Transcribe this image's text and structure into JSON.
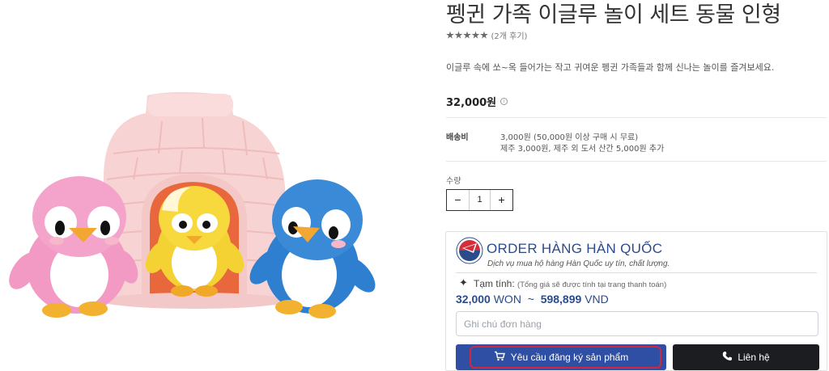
{
  "product": {
    "title": "펭귄 가족 이글루 놀이 세트 동물 인형",
    "rating_stars": 5,
    "review_count": "(2개 후기)",
    "description": "이글루 속에 쏘~옥 들어가는 작고 귀여운 펭귄 가족들과 함께 신나는 놀이를 즐겨보세요.",
    "price": "32,000원",
    "info_icon": "i",
    "shipping_label": "배송비",
    "shipping_line1": "3,000원 (50,000원 이상 구매 시 무료)",
    "shipping_line2": "제주 3,000원, 제주 외 도서 산간 5,000원 추가",
    "quantity_label": "수량",
    "quantity_minus": "−",
    "quantity_value": "1",
    "quantity_plus": "+"
  },
  "order_widget": {
    "brand_title": "ORDER HÀNG HÀN QUỐC",
    "brand_subtitle": "Dịch vụ mua hộ hàng Hàn Quốc uy tín, chất lượng.",
    "estimate_label": "Tạm tính:",
    "estimate_note": "(Tổng giá sẽ được tính tại trang thanh toán)",
    "estimate_won": "32,000",
    "estimate_won_unit": "WON",
    "estimate_sep": "~",
    "estimate_vnd": "598,899",
    "estimate_vnd_unit": "VND",
    "note_placeholder": "Ghi chú đơn hàng",
    "request_button": "Yêu cầu đăng ký sản phẩm",
    "contact_button": "Liên hệ"
  },
  "icons": {
    "sparkle": "sparkle-icon",
    "cart": "cart-icon",
    "phone": "phone-icon",
    "info": "info-icon",
    "logo": "korea-order-logo"
  },
  "colors": {
    "brand_blue": "#2e4fa3",
    "text_blue": "#2b4b8c",
    "contact_dark": "#1c1d20",
    "highlight_red": "#d0283a",
    "star_grey": "#6b6b6b"
  }
}
